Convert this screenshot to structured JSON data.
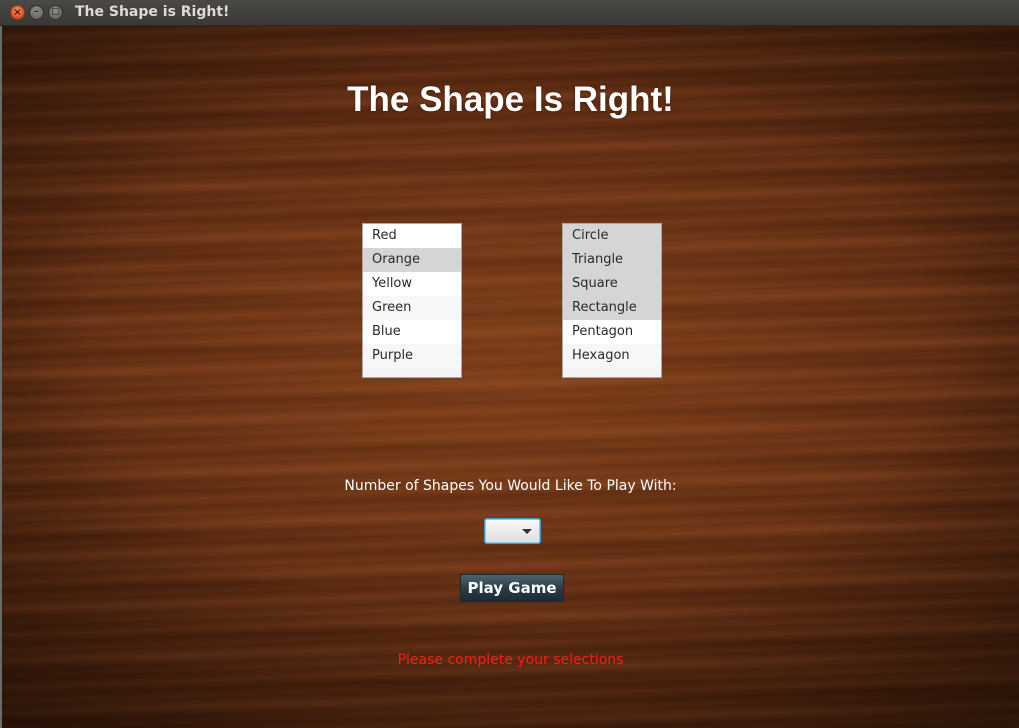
{
  "window": {
    "title": "The Shape is Right!",
    "controls": {
      "close_glyph": "×",
      "minimize_glyph": "–",
      "maximize_glyph": "□"
    }
  },
  "game": {
    "title": "The Shape Is Right!"
  },
  "colors_list": {
    "items": [
      {
        "label": "Red",
        "selected": false
      },
      {
        "label": "Orange",
        "selected": true
      },
      {
        "label": "Yellow",
        "selected": false
      },
      {
        "label": "Green",
        "selected": false
      },
      {
        "label": "Blue",
        "selected": false
      },
      {
        "label": "Purple",
        "selected": false
      }
    ]
  },
  "shapes_list": {
    "items": [
      {
        "label": "Circle",
        "selected": true
      },
      {
        "label": "Triangle",
        "selected": true
      },
      {
        "label": "Square",
        "selected": true
      },
      {
        "label": "Rectangle",
        "selected": true
      },
      {
        "label": "Pentagon",
        "selected": false
      },
      {
        "label": "Hexagon",
        "selected": false
      }
    ]
  },
  "shape_count": {
    "prompt": "Number of Shapes You Would Like To Play With:",
    "selected_value": "",
    "arrow_icon": "chevron-down-icon"
  },
  "play_button": {
    "label": "Play Game"
  },
  "status": {
    "message": "Please complete your selections",
    "color": "#ff1a1a"
  }
}
